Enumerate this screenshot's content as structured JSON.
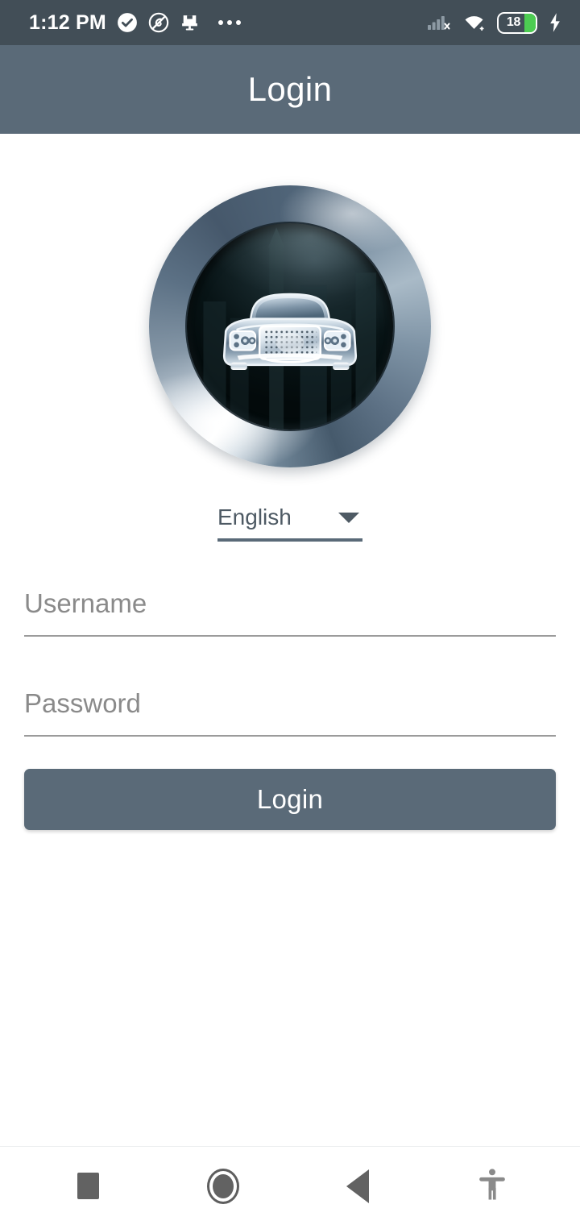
{
  "status_bar": {
    "time": "1:12 PM",
    "left_icons": [
      "check-circle-icon",
      "do-not-disturb-icon",
      "cast-screen-icon",
      "overflow-dots-icon"
    ],
    "right_icons": [
      "signal-no-sim-icon",
      "wifi-icon",
      "battery-icon",
      "charging-bolt-icon"
    ],
    "battery_level": "18",
    "battery_fill_color": "#4ccc52",
    "background_color": "#424e57",
    "foreground_color": "#ffffff"
  },
  "app_bar": {
    "title": "Login",
    "background_color": "#5a6a78",
    "title_color": "#ffffff"
  },
  "logo": {
    "name": "car-badge-logo",
    "alt": "Chrome car emblem in circular metallic badge",
    "ring_color": "#5c7185",
    "lens_color": "#081416",
    "car_color": "#c3d2dd"
  },
  "language_selector": {
    "name": "language-dropdown",
    "selected": "English",
    "icon": "chevron-down-icon",
    "underline_color": "#5a6a78",
    "text_color": "#4e5a64"
  },
  "form": {
    "username": {
      "placeholder": "Username",
      "value": ""
    },
    "password": {
      "placeholder": "Password",
      "value": ""
    },
    "submit_label": "Login",
    "submit_color": "#5a6a78",
    "placeholder_color": "#8a8a8a",
    "underline_color": "#9b9b9b"
  },
  "nav_bar": {
    "items": [
      {
        "name": "recents-button",
        "icon": "square-icon"
      },
      {
        "name": "home-button",
        "icon": "circle-icon"
      },
      {
        "name": "back-button",
        "icon": "triangle-left-icon"
      },
      {
        "name": "accessibility-button",
        "icon": "accessibility-icon"
      }
    ],
    "icon_color": "#626262",
    "background_color": "#ffffff"
  }
}
